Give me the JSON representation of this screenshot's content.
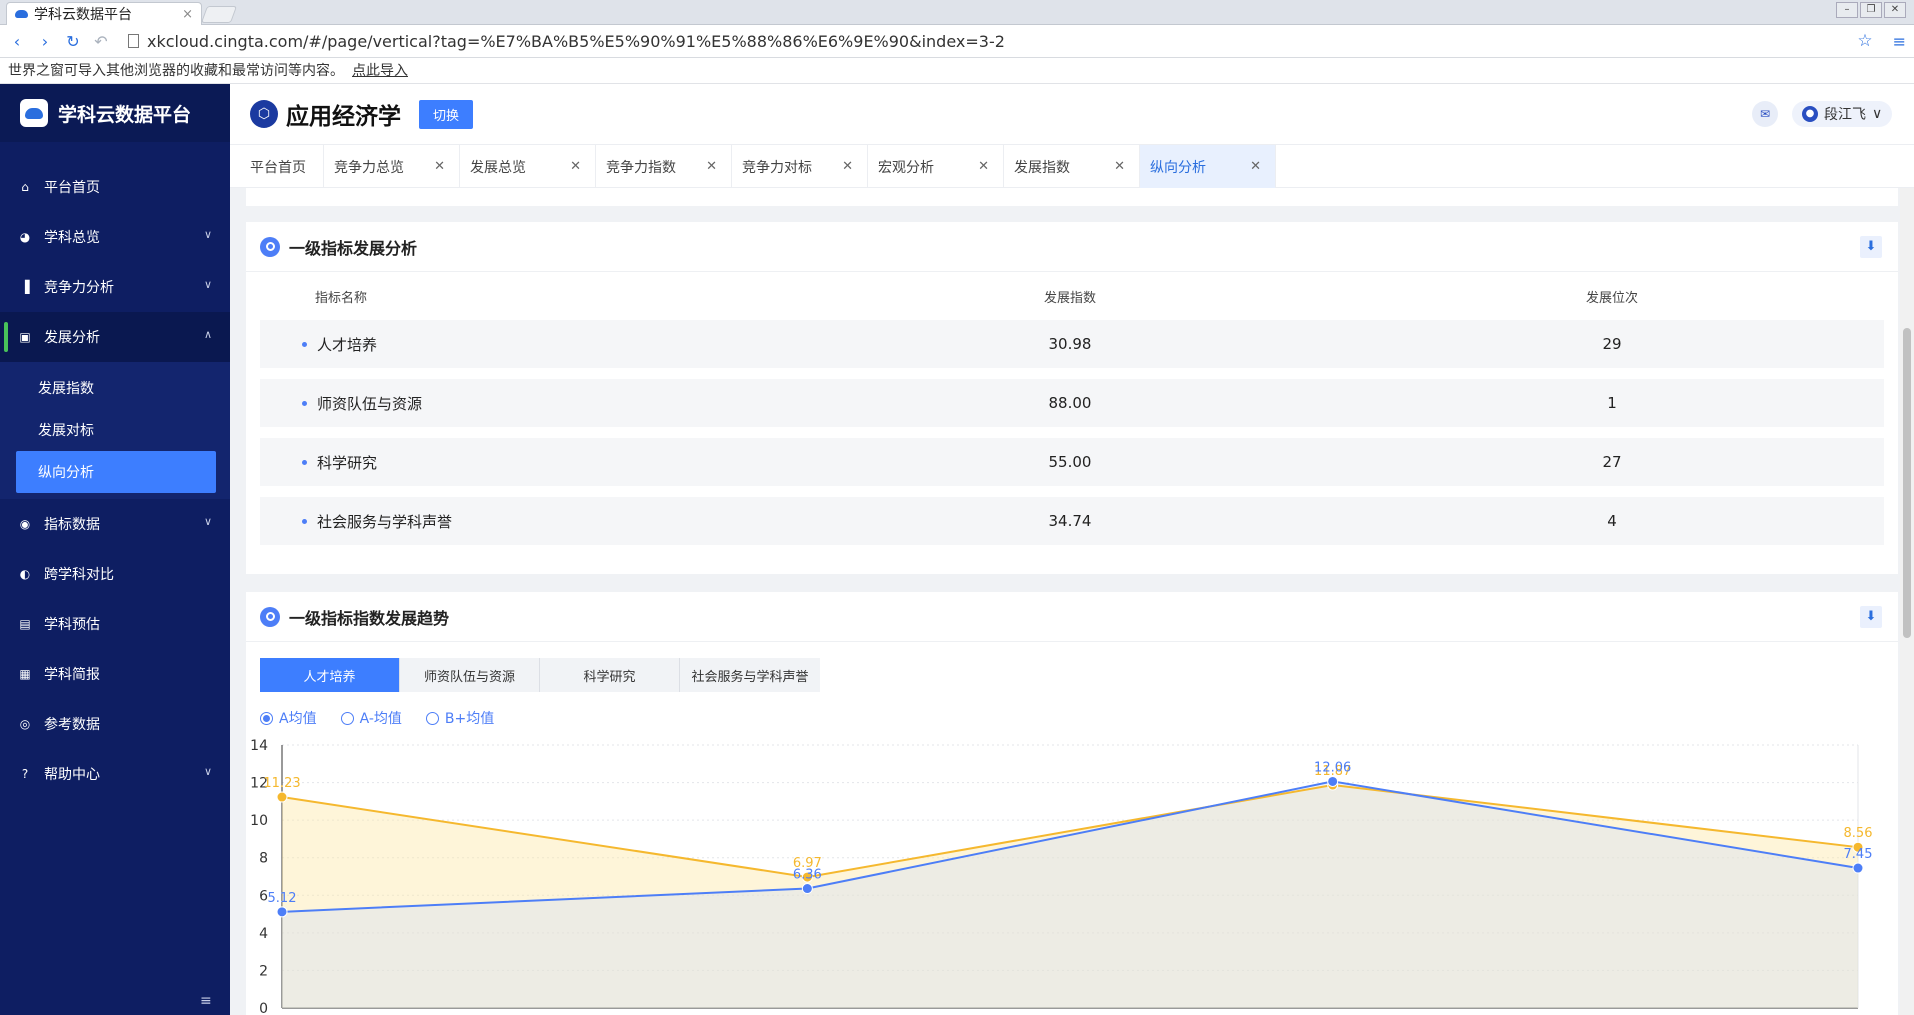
{
  "browser": {
    "tab_title": "学科云数据平台",
    "tab_close": "×",
    "url": "xkcloud.cingta.com/#/page/vertical?tag=%E7%BA%B5%E5%90%91%E5%88%86%E6%9E%90&index=3-2",
    "infobar_text": "世界之窗可导入其他浏览器的收藏和最常访问等内容。",
    "infobar_link": "点此导入"
  },
  "sidebar": {
    "logo_text": "学科云数据平台",
    "items": [
      {
        "label": "平台首页",
        "icon": "home-icon"
      },
      {
        "label": "学科总览",
        "icon": "pie-icon"
      },
      {
        "label": "竞争力分析",
        "icon": "bar-chart-icon"
      },
      {
        "label": "发展分析",
        "icon": "trend-icon"
      },
      {
        "label": "指标数据",
        "icon": "indicator-icon"
      },
      {
        "label": "跨学科对比",
        "icon": "contrast-icon"
      },
      {
        "label": "学科预估",
        "icon": "book-icon"
      },
      {
        "label": "学科简报",
        "icon": "report-icon"
      },
      {
        "label": "参考数据",
        "icon": "reference-icon"
      },
      {
        "label": "帮助中心",
        "icon": "help-icon"
      }
    ],
    "sub_items": [
      "发展指数",
      "发展对标",
      "纵向分析"
    ],
    "footer": "≡"
  },
  "header": {
    "title": "应用经济学",
    "switch_label": "切换",
    "user_name": "段江飞"
  },
  "tabs": [
    {
      "label": "平台首页",
      "closable": false
    },
    {
      "label": "竞争力总览",
      "closable": true
    },
    {
      "label": "发展总览",
      "closable": true
    },
    {
      "label": "竞争力指数",
      "closable": true
    },
    {
      "label": "竞争力对标",
      "closable": true
    },
    {
      "label": "宏观分析",
      "closable": true
    },
    {
      "label": "发展指数",
      "closable": true
    },
    {
      "label": "纵向分析",
      "closable": true,
      "active": true
    }
  ],
  "section1": {
    "title": "一级指标发展分析",
    "headers": [
      "指标名称",
      "发展指数",
      "发展位次"
    ],
    "rows": [
      [
        "人才培养",
        "30.98",
        "29"
      ],
      [
        "师资队伍与资源",
        "88.00",
        "1"
      ],
      [
        "科学研究",
        "55.00",
        "27"
      ],
      [
        "社会服务与学科声誉",
        "34.74",
        "4"
      ]
    ]
  },
  "section2": {
    "title": "一级指标指数发展趋势",
    "tabs": [
      "人才培养",
      "师资队伍与资源",
      "科学研究",
      "社会服务与学科声誉"
    ],
    "radios": [
      "A均值",
      "A-均值",
      "B+均值"
    ]
  },
  "chart_data": {
    "type": "area",
    "ylim": [
      0,
      14
    ],
    "yticks": [
      0,
      2,
      4,
      6,
      8,
      10,
      12,
      14
    ],
    "series": [
      {
        "values": [
          11.23,
          6.97,
          11.87,
          8.56
        ],
        "color": "#f5b82e"
      },
      {
        "values": [
          5.12,
          6.36,
          12.06,
          7.45
        ],
        "color": "#4d7ef7"
      }
    ],
    "labels": [
      [
        "11.23",
        "6.97",
        "11.87",
        "8.56"
      ],
      [
        "5.12",
        "6.36",
        "12.06",
        "7.45"
      ]
    ]
  },
  "colors": {
    "accent": "#3d7eff",
    "sidebar": "#0e1e62",
    "series_gold": "#f5b82e",
    "series_blue": "#4d7ef7"
  }
}
